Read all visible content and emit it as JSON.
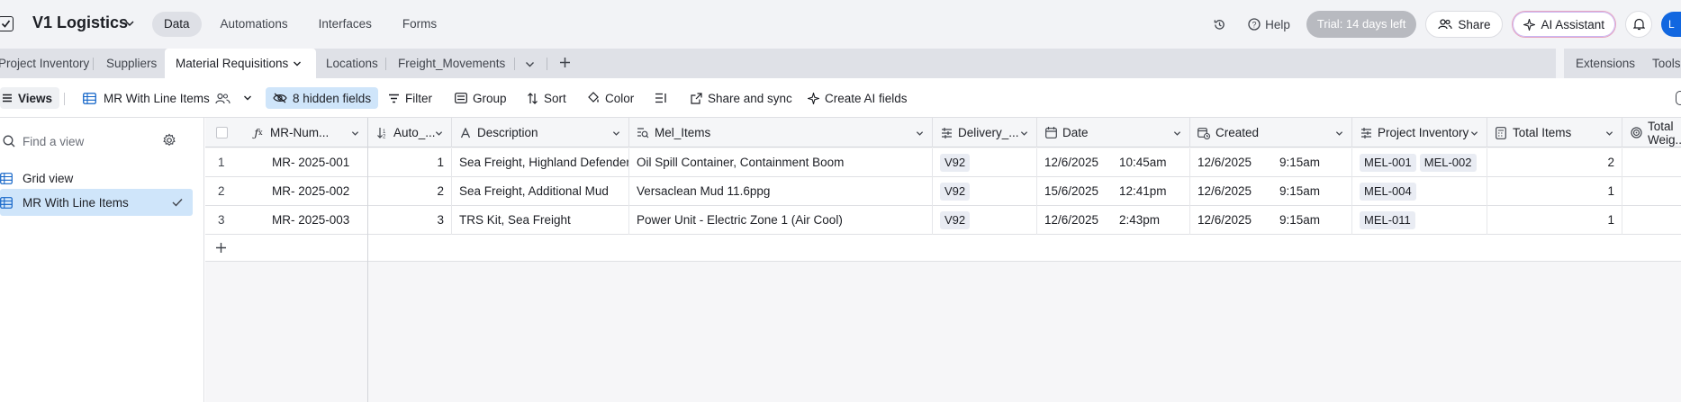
{
  "app": {
    "base_name": "V1 Logistics",
    "nav_tabs": [
      "Data",
      "Automations",
      "Interfaces",
      "Forms"
    ],
    "help_label": "Help",
    "trial_label": "Trial: 14 days left",
    "share_label": "Share",
    "ai_label": "AI Assistant",
    "avatar_initial": "L"
  },
  "tables": {
    "tabs": [
      "Project Inventory",
      "Suppliers",
      "Material Requisitions",
      "Locations",
      "Freight_Movements"
    ],
    "active": "Material Requisitions",
    "extensions_label": "Extensions",
    "tools_label": "Tools"
  },
  "viewbar": {
    "views_label": "Views",
    "current_view": "MR With Line Items",
    "hidden_fields": "8 hidden fields",
    "filter": "Filter",
    "group": "Group",
    "sort": "Sort",
    "color": "Color",
    "share_sync": "Share and sync",
    "create_ai": "Create AI fields"
  },
  "sidebar": {
    "find_placeholder": "Find a view",
    "views": [
      "Grid view",
      "MR With Line Items"
    ]
  },
  "grid": {
    "columns": [
      "MR-Num...",
      "Auto_...",
      "Description",
      "Mel_Items",
      "Delivery_...",
      "Date",
      "Created",
      "Project Inventory",
      "Total Items",
      "Total Weig..."
    ],
    "rows": [
      {
        "n": "1",
        "mr": "MR- 2025-001",
        "auto": "1",
        "desc": "Sea Freight, Highland Defender",
        "mel": "Oil Spill Container, Containment Boom",
        "delivery": "V92",
        "date": "12/6/2025",
        "date_time": "10:45am",
        "created": "12/6/2025",
        "created_time": "9:15am",
        "inventory": [
          "MEL-001",
          "MEL-002"
        ],
        "total": "2"
      },
      {
        "n": "2",
        "mr": "MR- 2025-002",
        "auto": "2",
        "desc": "Sea Freight, Additional Mud",
        "mel": "Versaclean Mud 11.6ppg",
        "delivery": "V92",
        "date": "15/6/2025",
        "date_time": "12:41pm",
        "created": "12/6/2025",
        "created_time": "9:15am",
        "inventory": [
          "MEL-004"
        ],
        "total": "1"
      },
      {
        "n": "3",
        "mr": "MR- 2025-003",
        "auto": "3",
        "desc": "TRS Kit, Sea Freight",
        "mel": "Power Unit - Electric Zone 1 (Air Cool)",
        "delivery": "V92",
        "date": "12/6/2025",
        "date_time": "2:43pm",
        "created": "12/6/2025",
        "created_time": "9:15am",
        "inventory": [
          "MEL-011"
        ],
        "total": "1"
      }
    ]
  }
}
